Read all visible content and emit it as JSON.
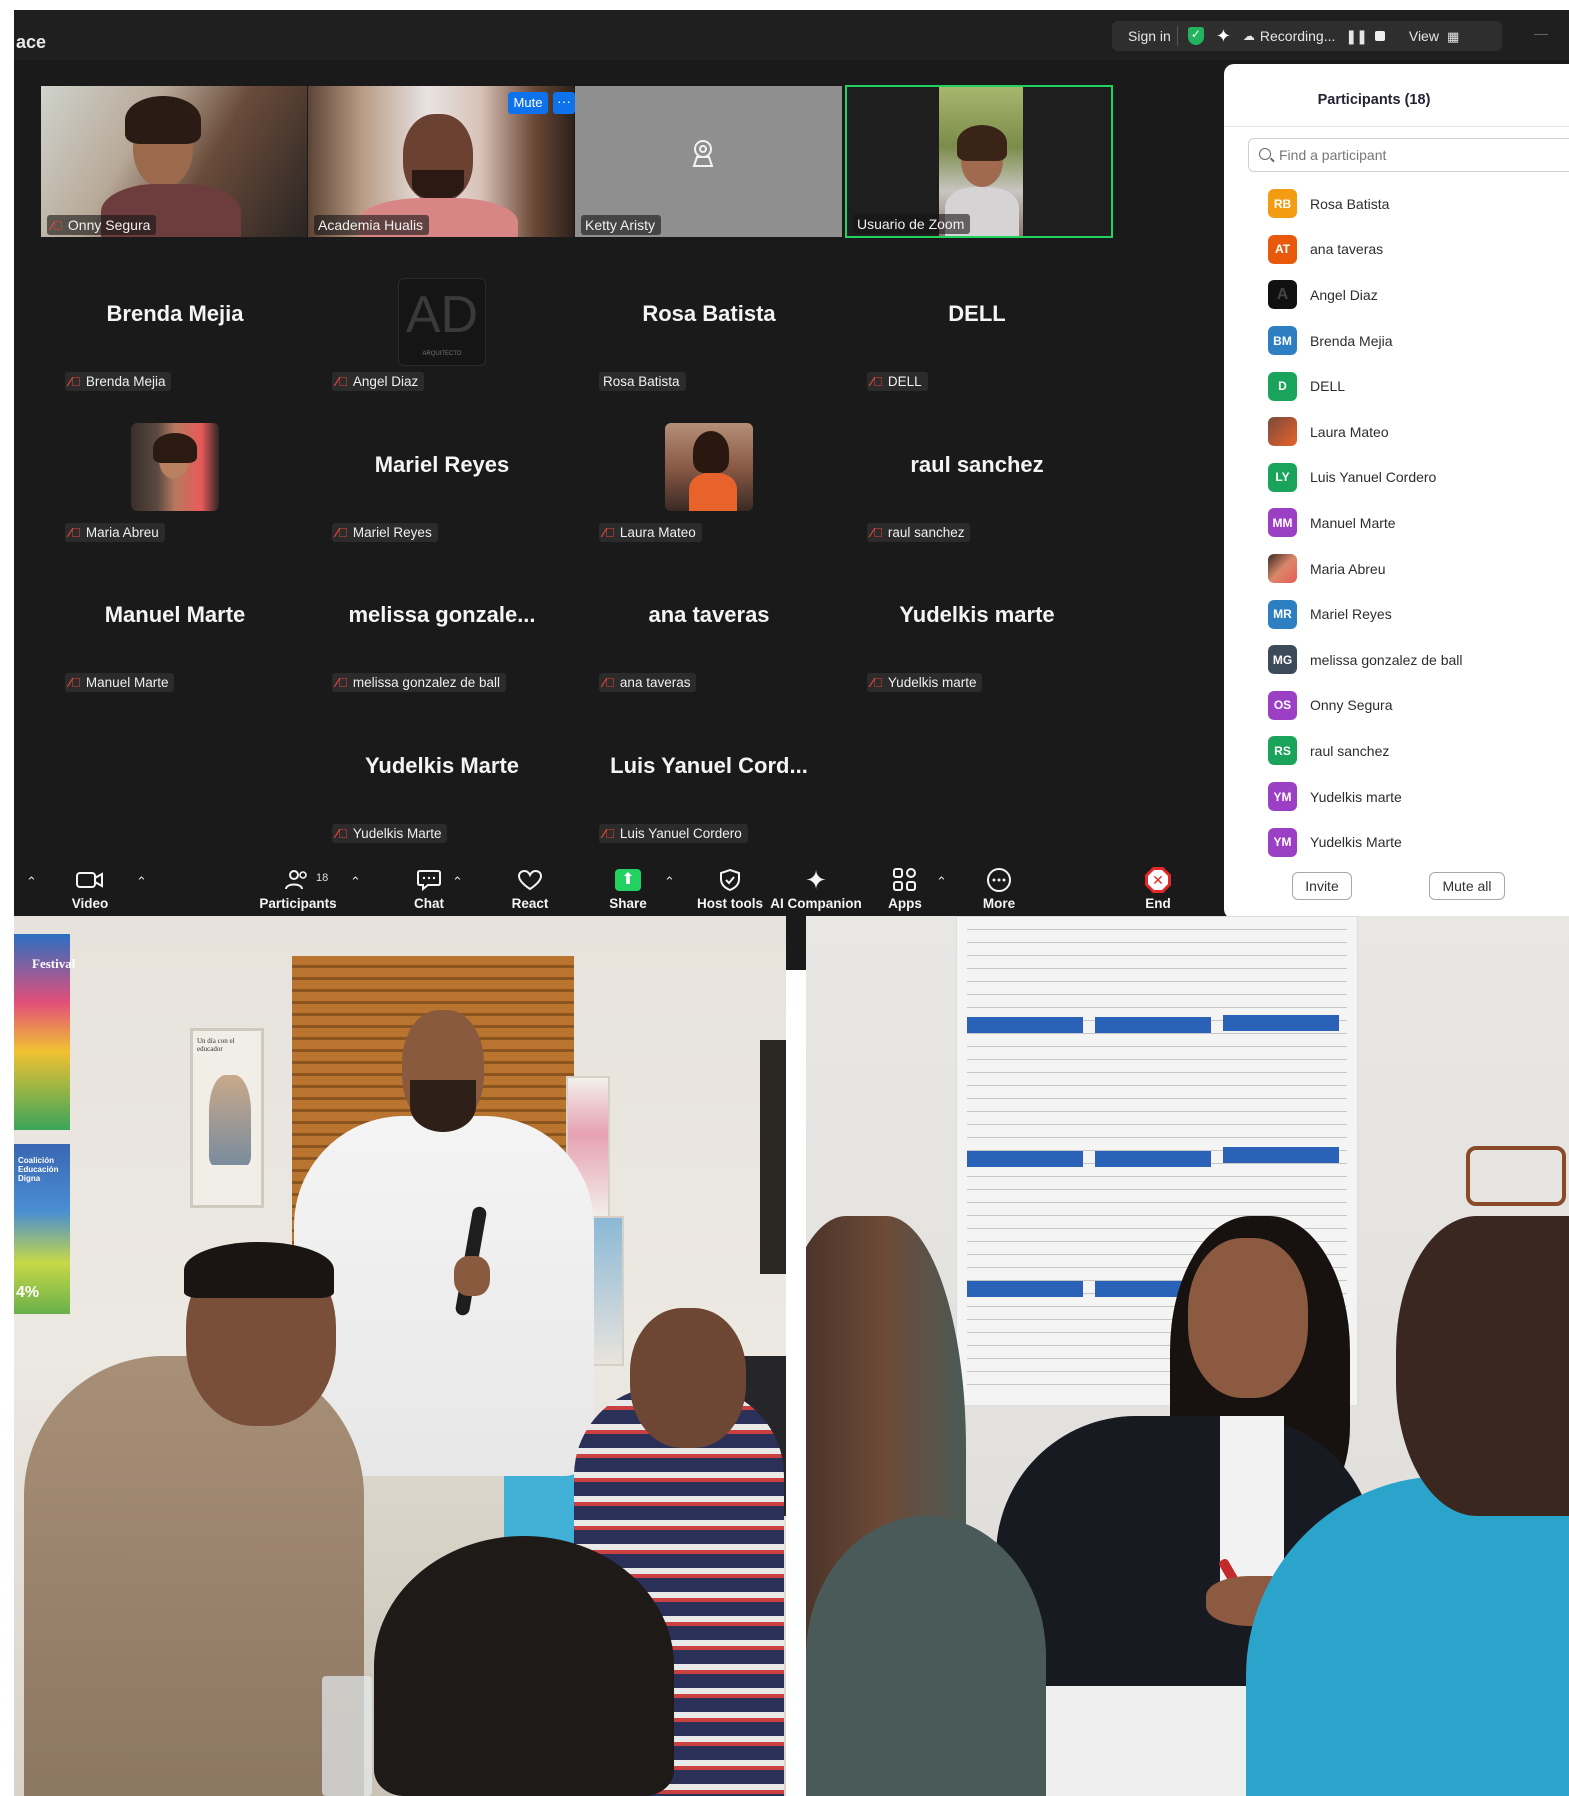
{
  "app": {
    "title_fragment": "ace"
  },
  "topbar": {
    "sign_in": "Sign in",
    "recording": "Recording...",
    "view": "View"
  },
  "top_tiles": [
    {
      "name": "Onny Segura",
      "muted": true
    },
    {
      "name": "Academia Hualis",
      "muted": false
    },
    {
      "name": "Ketty Aristy",
      "muted": false
    },
    {
      "name": "Usuario de Zoom",
      "muted": false
    }
  ],
  "tile_controls": {
    "mute": "Mute",
    "more": "···"
  },
  "gallery": [
    {
      "display": "Brenda Mejia",
      "label": "Brenda Mejia",
      "muted": true
    },
    {
      "display": "",
      "label": "Angel Diaz",
      "muted": true
    },
    {
      "display": "Rosa Batista",
      "label": "Rosa Batista",
      "muted": false
    },
    {
      "display": "DELL",
      "label": "DELL",
      "muted": true
    },
    {
      "display": "",
      "label": "Maria Abreu",
      "muted": true
    },
    {
      "display": "Mariel Reyes",
      "label": "Mariel Reyes",
      "muted": true
    },
    {
      "display": "",
      "label": "Laura Mateo",
      "muted": true
    },
    {
      "display": "raul sanchez",
      "label": "raul sanchez",
      "muted": true
    },
    {
      "display": "Manuel Marte",
      "label": "Manuel Marte",
      "muted": true
    },
    {
      "display": "melissa  gonzale...",
      "label": "melissa gonzalez de ball",
      "muted": true
    },
    {
      "display": "ana taveras",
      "label": "ana taveras",
      "muted": true
    },
    {
      "display": "Yudelkis marte",
      "label": "Yudelkis marte",
      "muted": true
    },
    {
      "display": "Yudelkis Marte",
      "label": "Yudelkis Marte",
      "muted": true
    },
    {
      "display": "Luis Yanuel Cord...",
      "label": "Luis Yanuel Cordero",
      "muted": true
    }
  ],
  "angel_logo": {
    "letters": "AD",
    "sub": "ARQUITECTO"
  },
  "panel": {
    "title": "Participants (18)",
    "search_placeholder": "Find a participant",
    "participants": [
      {
        "initials": "RB",
        "name": "Rosa Batista",
        "color": "#f39c12"
      },
      {
        "initials": "AT",
        "name": "ana taveras",
        "color": "#e8590c"
      },
      {
        "initials": "",
        "name": "Angel Diaz",
        "color": "#111111"
      },
      {
        "initials": "BM",
        "name": "Brenda Mejia",
        "color": "#2d7fc1"
      },
      {
        "initials": "D",
        "name": "DELL",
        "color": "#1aa35a"
      },
      {
        "initials": "",
        "name": "Laura Mateo",
        "color": "#c96a3d"
      },
      {
        "initials": "LY",
        "name": "Luis Yanuel Cordero",
        "color": "#1aa35a"
      },
      {
        "initials": "MM",
        "name": "Manuel Marte",
        "color": "#9b3fc4"
      },
      {
        "initials": "",
        "name": "Maria Abreu",
        "color": "#c98a6a"
      },
      {
        "initials": "MR",
        "name": "Mariel Reyes",
        "color": "#2d7fc1"
      },
      {
        "initials": "MG",
        "name": "melissa gonzalez de ball",
        "color": "#3d4a5a"
      },
      {
        "initials": "OS",
        "name": "Onny Segura",
        "color": "#9b3fc4"
      },
      {
        "initials": "RS",
        "name": "raul sanchez",
        "color": "#1aa35a"
      },
      {
        "initials": "YM",
        "name": "Yudelkis marte",
        "color": "#9b3fc4"
      },
      {
        "initials": "YM",
        "name": "Yudelkis Marte",
        "color": "#9b3fc4"
      }
    ],
    "invite": "Invite",
    "mute_all": "Mute all",
    "more": "···"
  },
  "toolbar": {
    "video": "Video",
    "participants": "Participants",
    "participants_count": "18",
    "chat": "Chat",
    "react": "React",
    "share": "Share",
    "host_tools": "Host tools",
    "ai_companion": "AI Companion",
    "apps": "Apps",
    "more": "More",
    "end": "End"
  },
  "photos": {
    "left_poster": "Festival",
    "left_poster2": "Coalición Educación Digna",
    "left_poster2_pct": "4%",
    "book_cover": "Un día con el educador"
  },
  "colors": {
    "accent": "#0e72ed",
    "active_speaker": "#23d160",
    "muted": "#e8453c",
    "end": "#e02828"
  }
}
